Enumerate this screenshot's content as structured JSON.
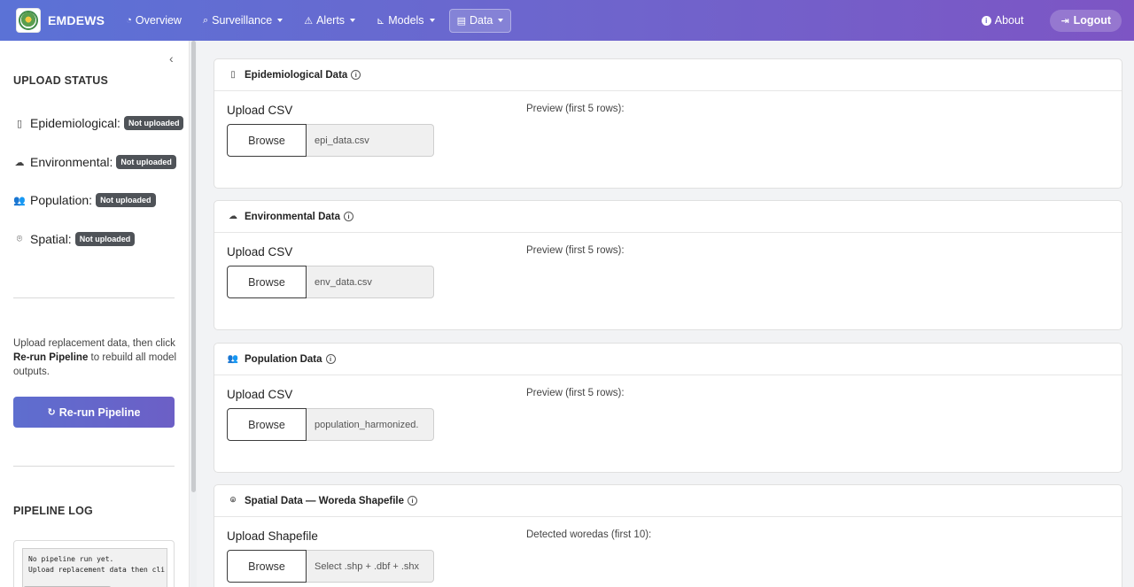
{
  "navbar": {
    "brand": "EMDEWS",
    "items": [
      {
        "label": "Overview",
        "icon": "⏲",
        "caret": false,
        "active": false
      },
      {
        "label": "Surveillance",
        "icon": "🔍",
        "caret": true,
        "active": false
      },
      {
        "label": "Alerts",
        "icon": "⚠",
        "caret": true,
        "active": false
      },
      {
        "label": "Models",
        "icon": "📈",
        "caret": true,
        "active": false
      },
      {
        "label": "Data",
        "icon": "☰",
        "caret": true,
        "active": true
      }
    ],
    "about": "About",
    "logout": "Logout"
  },
  "sidebar": {
    "upload_status_heading": "UPLOAD STATUS",
    "statuses": [
      {
        "label": "Epidemiological:",
        "badge": "Not uploaded",
        "icon": "file-medical-icon"
      },
      {
        "label": "Environmental:",
        "badge": "Not uploaded",
        "icon": "cloud-icon"
      },
      {
        "label": "Population:",
        "badge": "Not uploaded",
        "icon": "people-icon"
      },
      {
        "label": "Spatial:",
        "badge": "Not uploaded",
        "icon": "map-pin-icon"
      }
    ],
    "help_text_pre": "Upload replacement data, then click ",
    "help_text_bold": "Re-run Pipeline",
    "help_text_post": " to rebuild all model outputs.",
    "rerun_button": "Re-run Pipeline",
    "pipeline_log_heading": "PIPELINE LOG",
    "log_lines": [
      "No pipeline run yet.",
      "Upload replacement data then cli"
    ]
  },
  "cards": [
    {
      "title": "Epidemiological Data",
      "upload_label": "Upload CSV",
      "browse": "Browse",
      "file": "epi_data.csv",
      "preview": "Preview (first 5 rows):"
    },
    {
      "title": "Environmental Data",
      "upload_label": "Upload CSV",
      "browse": "Browse",
      "file": "env_data.csv",
      "preview": "Preview (first 5 rows):"
    },
    {
      "title": "Population Data",
      "upload_label": "Upload CSV",
      "browse": "Browse",
      "file": "population_harmonized.",
      "preview": "Preview (first 5 rows):"
    },
    {
      "title": "Spatial Data — Woreda Shapefile",
      "upload_label": "Upload Shapefile",
      "browse": "Browse",
      "file": "Select .shp + .dbf + .shx",
      "preview": "Detected woredas (first 10):"
    }
  ],
  "colors": {
    "nav_start": "#5b72d6",
    "nav_end": "#7d55c4",
    "badge": "#4f5358",
    "button": "#6366cc"
  }
}
